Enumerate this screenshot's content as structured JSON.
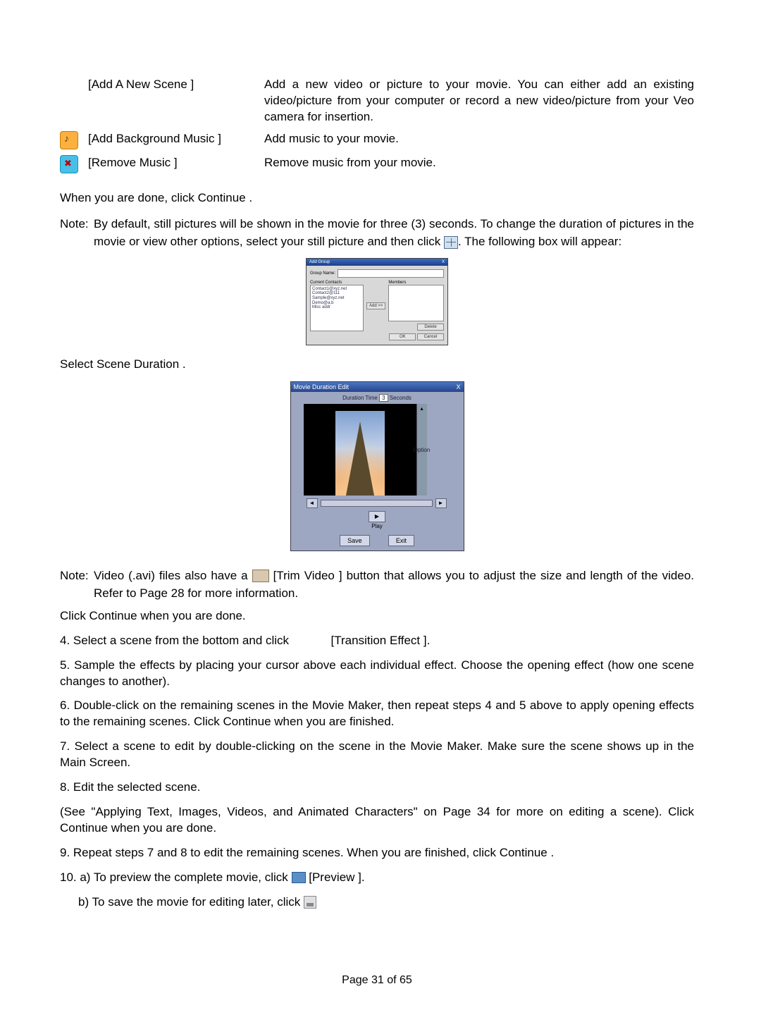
{
  "table": {
    "rows": [
      {
        "label": "[Add A New Scene ]",
        "desc": "Add a new video or picture to your movie. You can either add an existing video/picture from your computer or record a new video/picture from your Veo camera for insertion."
      },
      {
        "label": "[Add Background Music  ]",
        "desc": "Add music to your movie."
      },
      {
        "label": "[Remove Music ]",
        "desc": "Remove music from your movie."
      }
    ]
  },
  "p_done": "When you are done, click Continue .",
  "note1": {
    "label": "Note:",
    "line1": "By default, still pictures will be shown in the movie for three (3) seconds. To change the duration of",
    "line2a": "pictures in the movie or view other options, select your still picture and then click ",
    "line2b": ". The following box will appear:"
  },
  "dialog1": {
    "title": "Add Group",
    "close": "X",
    "group_label": "Group Name:",
    "left_header": "Current Contacts",
    "right_header": "Members",
    "list": [
      "Contact1@xyz.net",
      "Contact2@111",
      "Sample@xyz.net",
      "Demo@a.b",
      "Misc addr"
    ],
    "add_btn": "Add >>",
    "del_btn": "Delete",
    "ok": "OK",
    "cancel": "Cancel"
  },
  "p_select": "Select Scene Duration  .",
  "dialog2": {
    "title": "Movie Duration Edit",
    "close": "X",
    "dur_a": "Duration Time",
    "dur_val": "3",
    "dur_b": "Seconds",
    "option": "Option",
    "back": "◄",
    "fwd": "►",
    "play_glyph": "▶",
    "play": "Play",
    "save": "Save",
    "exit": "Exit"
  },
  "note2": {
    "label": "Note:",
    "a": "Video (.avi) files also have a ",
    "b": " [Trim Video ] button that allows you to adjust the size and length of the video. Refer to Page 28 for more information."
  },
  "p_click": "Click Continue  when you are done.",
  "p4a": "4. Select a scene from the bottom and click",
  "p4b": "[Transition Effect  ].",
  "p5": "5. Sample the effects by placing your cursor above each individual effect. Choose the opening effect (how one scene changes to another).",
  "p6": "6. Double-click on the remaining scenes in the Movie Maker, then repeat steps 4 and 5 above to apply opening effects to the remaining scenes.  Click Continue  when you are finished.",
  "p7": "7. Select a scene to edit by double-clicking on the scene in the Movie Maker.  Make sure the scene shows up in the Main Screen.",
  "p8": "8. Edit the selected scene.",
  "p8b": "(See \"Applying Text, Images, Videos, and Animated Characters\" on Page 34 for more on editing a scene). Click Continue  when you are done.",
  "p9": "9. Repeat steps 7 and 8 to edit the remaining scenes.  When you are finished, click Continue .",
  "p10a": "10. a) To preview the complete movie, click ",
  "p10a2": " [Preview ].",
  "p10b": "b) To save the movie for editing later, click ",
  "footer": "Page 31 of 65"
}
